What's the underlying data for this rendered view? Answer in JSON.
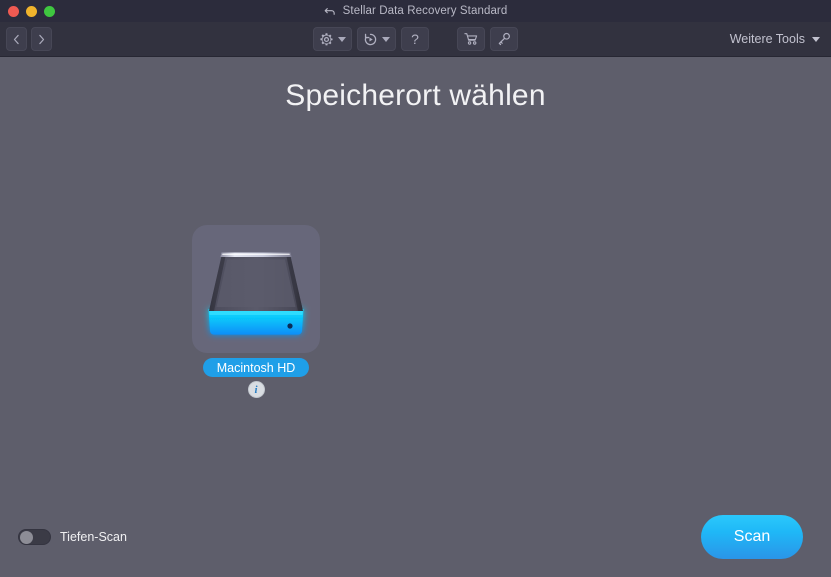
{
  "window": {
    "title": "Stellar Data Recovery Standard",
    "title_icon": "back-arrow-icon",
    "traffic_lights": [
      {
        "name": "close",
        "color": "#ef5a52"
      },
      {
        "name": "minimize",
        "color": "#f1b42c"
      },
      {
        "name": "maximize",
        "color": "#3fc740"
      }
    ]
  },
  "toolbar": {
    "back_icon": "chevron-left-icon",
    "forward_icon": "chevron-right-icon",
    "settings_icon": "gear-icon",
    "resume_icon": "resume-recovery-icon",
    "help_label": "?",
    "cart_icon": "shopping-cart-icon",
    "activation_icon": "key-icon",
    "more_tools_label": "Weitere Tools",
    "dropdown_icon": "chevron-down-icon"
  },
  "main": {
    "page_title": "Speicherort wählen",
    "drive": {
      "icon": "hard-drive-icon",
      "label": "Macintosh HD",
      "info_label": "i",
      "selected": true
    }
  },
  "footer": {
    "deep_scan_label": "Tiefen-Scan",
    "deep_scan_enabled": false,
    "scan_button_label": "Scan"
  },
  "colors": {
    "titlebar": "#2c2c3c",
    "toolbar": "#32323f",
    "canvas": "#5e5e6b",
    "tile": "#67677a",
    "accent_blue": "#1f9fe8",
    "accent_cyan": "#2bc8fb",
    "text_primary": "#f2f2f4",
    "text_muted": "#b9b9c6"
  }
}
